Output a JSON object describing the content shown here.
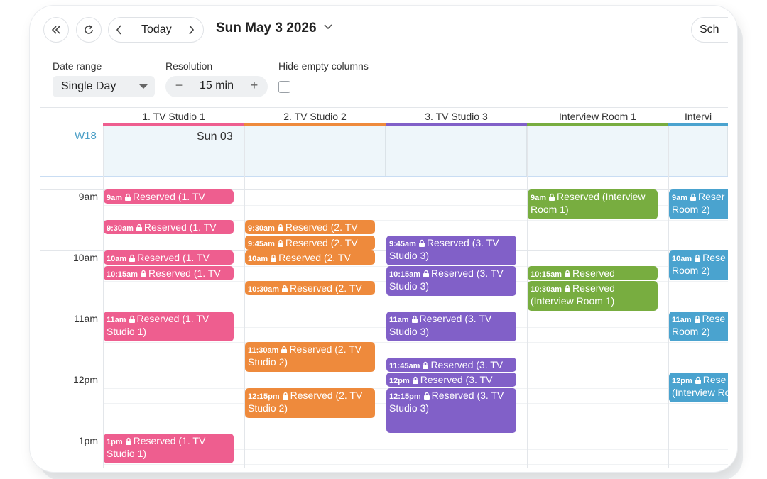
{
  "toolbar": {
    "today_label": "Today",
    "date_title": "Sun May 3 2026",
    "schedule_label": "Sch"
  },
  "filters": {
    "date_range_label": "Date range",
    "date_range_value": "Single Day",
    "resolution_label": "Resolution",
    "resolution_value": "15 min",
    "minus": "−",
    "plus": "+",
    "hide_empty_label": "Hide empty columns"
  },
  "calendar": {
    "week": "W18",
    "day": "Sun 03",
    "columns": [
      {
        "name": "1. TV Studio 1",
        "color": "#ee5e8f"
      },
      {
        "name": "2. TV Studio 2",
        "color": "#ee8a3c"
      },
      {
        "name": "3. TV Studio 3",
        "color": "#8160c8"
      },
      {
        "name": "Interview Room 1",
        "color": "#78ad40"
      },
      {
        "name": "Intervi",
        "color": "#4aa3cf"
      }
    ],
    "hours": [
      "9am",
      "10am",
      "11am",
      "12pm",
      "1pm"
    ],
    "events": [
      {
        "time": "9am",
        "text": "Reserved (1. TV"
      },
      {
        "time": "9:30am",
        "text": "Reserved (1. TV"
      },
      {
        "time": "10am",
        "text": "Reserved (1. TV"
      },
      {
        "time": "10:15am",
        "text": "Reserved (1. TV"
      },
      {
        "time": "11am",
        "text": "Reserved (1. TV Studio 1)"
      },
      {
        "time": "1pm",
        "text": "Reserved (1. TV Studio 1)"
      },
      {
        "time": "9:30am",
        "text": "Reserved (2. TV"
      },
      {
        "time": "9:45am",
        "text": "Reserved (2. TV"
      },
      {
        "time": "10am",
        "text": "Reserved (2. TV"
      },
      {
        "time": "10:30am",
        "text": "Reserved (2. TV"
      },
      {
        "time": "11:30am",
        "text": "Reserved (2. TV Studio 2)"
      },
      {
        "time": "12:15pm",
        "text": "Reserved (2. TV Studio 2)"
      },
      {
        "time": "9:45am",
        "text": "Reserved (3. TV Studio 3)"
      },
      {
        "time": "10:15am",
        "text": "Reserved (3. TV Studio 3)"
      },
      {
        "time": "11am",
        "text": "Reserved (3. TV Studio 3)"
      },
      {
        "time": "11:45am",
        "text": "Reserved (3. TV"
      },
      {
        "time": "12pm",
        "text": "Reserved (3. TV"
      },
      {
        "time": "12:15pm",
        "text": "Reserved (3. TV Studio 3)"
      },
      {
        "time": "9am",
        "text": "Reserved (Interview Room 1)"
      },
      {
        "time": "10:15am",
        "text": "Reserved"
      },
      {
        "time": "10:30am",
        "text": "Reserved (Interview Room 1)"
      },
      {
        "time": "9am",
        "text": "Reser Room 2)"
      },
      {
        "time": "10am",
        "text": "Rese Room 2)"
      },
      {
        "time": "11am",
        "text": "Rese Room 2)"
      },
      {
        "time": "12pm",
        "text": "Rese (Interview Ro"
      }
    ]
  }
}
